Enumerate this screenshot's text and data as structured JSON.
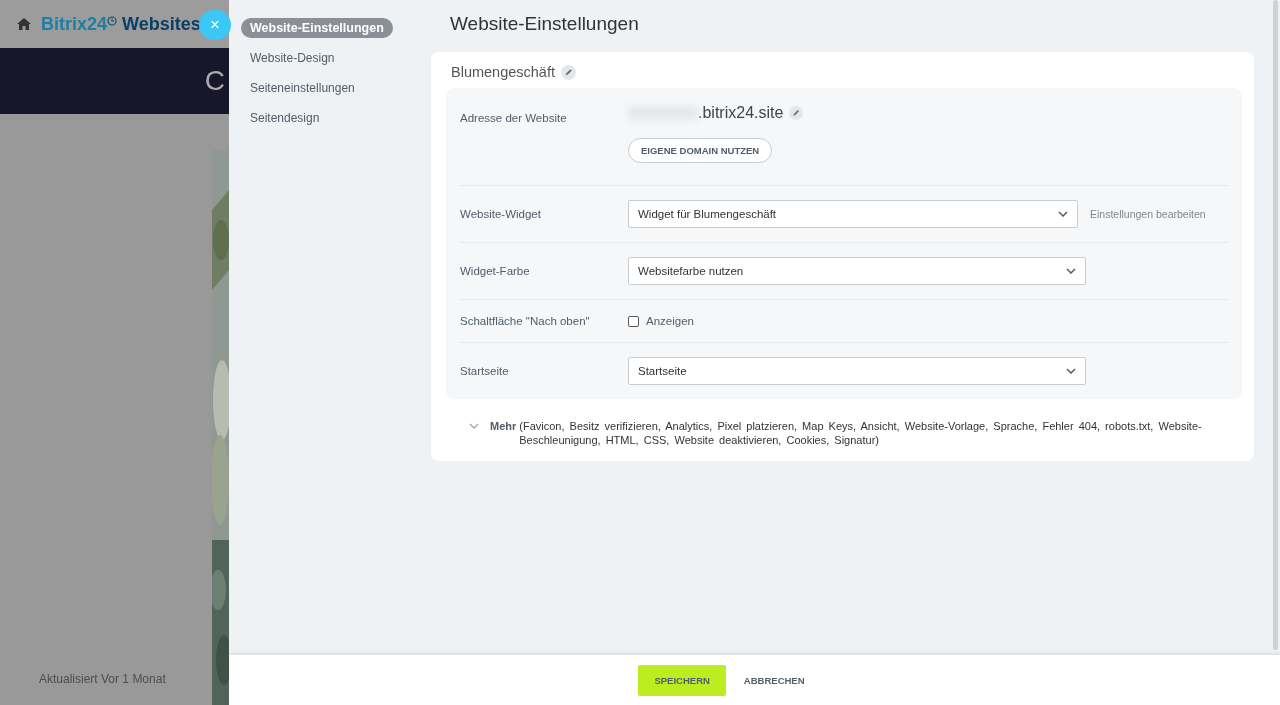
{
  "background": {
    "logo": {
      "brand": "Bitrix24",
      "suffix": "Websites"
    },
    "banner_text": "C",
    "updated": "Aktualisiert Vor 1 Monat"
  },
  "close_button": {
    "label": "×"
  },
  "nav": [
    {
      "label": "Website-Einstellungen",
      "selected": true
    },
    {
      "label": "Website-Design",
      "selected": false
    },
    {
      "label": "Seiteneinstellungen",
      "selected": false
    },
    {
      "label": "Seitendesign",
      "selected": false
    }
  ],
  "title": "Website-Einstellungen",
  "site_name": "Blumengeschäft",
  "rows": [
    {
      "kind": "address",
      "label": "Adresse der Website",
      "domain": ".bitrix24.site",
      "button": "EIGENE DOMAIN NUTZEN"
    },
    {
      "kind": "select",
      "label": "Website-Widget",
      "value": "Widget für Blumengeschäft",
      "link": "Einstellungen bearbeiten"
    },
    {
      "kind": "select",
      "label": "Widget-Farbe",
      "value": "Websitefarbe nutzen"
    },
    {
      "kind": "checkbox",
      "label": "Schaltfläche \"Nach oben\"",
      "option": "Anzeigen",
      "checked": false
    },
    {
      "kind": "select",
      "label": "Startseite",
      "value": "Startseite"
    }
  ],
  "more": {
    "label": "Mehr",
    "text": "(Favicon,  Besitz verifizieren,  Analytics,  Pixel platzieren,  Map Keys,  Ansicht,  Website-Vorlage,  Sprache,  Fehler 404,  robots.txt,  Website-Beschleunigung,  HTML,  CSS,  Website deaktivieren,  Cookies,  Signatur)",
    "expanded": false
  },
  "footer": {
    "save": "SPEICHERN",
    "cancel": "ABBRECHEN"
  }
}
